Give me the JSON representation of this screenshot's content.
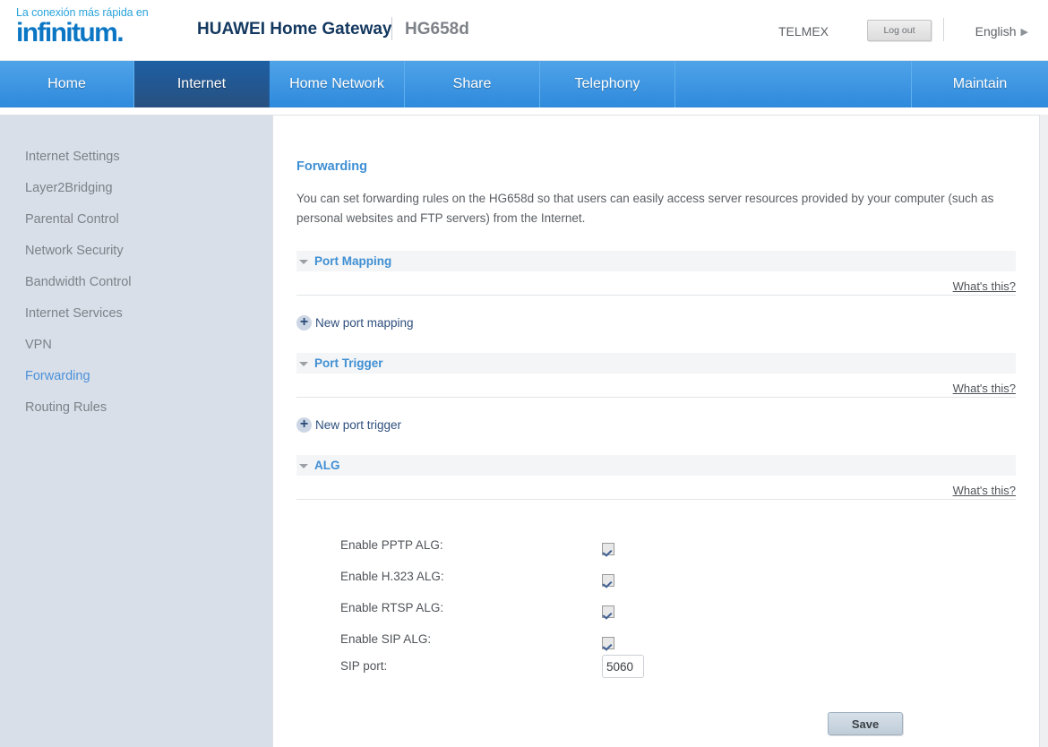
{
  "header": {
    "logo_tagline": "La conexión más rápida en",
    "logo_word": "infinitum",
    "logo_dot": ".",
    "brand": "HUAWEI Home Gateway",
    "model": "HG658d",
    "account": "TELMEX",
    "logout_label": "Log out",
    "language": "English",
    "language_arrow": "▶"
  },
  "nav": {
    "items": [
      {
        "label": "Home",
        "active": false
      },
      {
        "label": "Internet",
        "active": true
      },
      {
        "label": "Home Network",
        "active": false
      },
      {
        "label": "Share",
        "active": false
      },
      {
        "label": "Telephony",
        "active": false
      },
      {
        "label": "Maintain",
        "active": false
      }
    ]
  },
  "sidebar": {
    "items": [
      {
        "label": "Internet Settings",
        "active": false
      },
      {
        "label": "Layer2Bridging",
        "active": false
      },
      {
        "label": "Parental Control",
        "active": false
      },
      {
        "label": "Network Security",
        "active": false
      },
      {
        "label": "Bandwidth Control",
        "active": false
      },
      {
        "label": "Internet Services",
        "active": false
      },
      {
        "label": "VPN",
        "active": false
      },
      {
        "label": "Forwarding",
        "active": true
      },
      {
        "label": "Routing Rules",
        "active": false
      }
    ]
  },
  "main": {
    "title": "Forwarding",
    "description": "You can set forwarding rules on the HG658d so that users can easily access server resources provided by your computer (such as personal websites and FTP servers) from the Internet.",
    "whats_this": "What's this?",
    "sections": {
      "port_mapping": {
        "title": "Port Mapping",
        "collapse_icon": "triangle-down-icon",
        "add_label": "New port mapping",
        "add_icon": "plus-circle-icon"
      },
      "port_trigger": {
        "title": "Port Trigger",
        "collapse_icon": "triangle-down-icon",
        "add_label": "New port trigger",
        "add_icon": "plus-circle-icon"
      },
      "alg": {
        "title": "ALG",
        "collapse_icon": "triangle-down-icon",
        "fields": [
          {
            "label": "Enable PPTP ALG:",
            "checked": true
          },
          {
            "label": "Enable H.323 ALG:",
            "checked": true
          },
          {
            "label": "Enable RTSP ALG:",
            "checked": true
          },
          {
            "label": "Enable SIP ALG:",
            "checked": true
          }
        ],
        "sip_port_label": "SIP port:",
        "sip_port_value": "5060"
      }
    },
    "save_label": "Save"
  },
  "colors": {
    "nav_active": "#1e5fa4",
    "accent_blue": "#3f8fd4",
    "sidebar_bg": "#d9dfe8",
    "link_blue": "#2e4f7d",
    "logo_blue": "#0b76c4",
    "logo_cyan": "#29a3dc"
  }
}
